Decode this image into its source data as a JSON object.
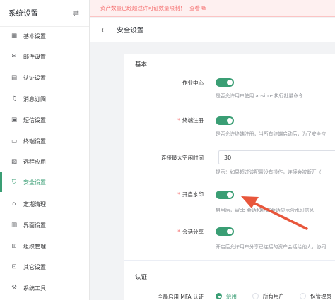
{
  "sidebar": {
    "title": "系统设置",
    "items": [
      {
        "icon": "grid-icon",
        "glyph": "▦",
        "label": "基本设置"
      },
      {
        "icon": "mail-icon",
        "glyph": "✉",
        "label": "邮件设置"
      },
      {
        "icon": "id-card-icon",
        "glyph": "▤",
        "label": "认证设置"
      },
      {
        "icon": "bell-icon",
        "glyph": "♫",
        "label": "消息订阅"
      },
      {
        "icon": "sms-icon",
        "glyph": "▣",
        "label": "短信设置"
      },
      {
        "icon": "monitor-icon",
        "glyph": "▭",
        "label": "终端设置"
      },
      {
        "icon": "app-icon",
        "glyph": "▧",
        "label": "远程应用"
      },
      {
        "icon": "shield-icon",
        "glyph": "⛉",
        "label": "安全设置"
      },
      {
        "icon": "broom-icon",
        "glyph": "⌂",
        "label": "定期清理"
      },
      {
        "icon": "layout-icon",
        "glyph": "▥",
        "label": "界面设置"
      },
      {
        "icon": "org-icon",
        "glyph": "⊞",
        "label": "组织管理"
      },
      {
        "icon": "more-icon",
        "glyph": "⊡",
        "label": "其它设置"
      },
      {
        "icon": "tools-icon",
        "glyph": "⚒",
        "label": "系统工具"
      }
    ],
    "active_index": 7
  },
  "notice": {
    "text": "资产数量已经超过许可证数量限制！",
    "link": "查看"
  },
  "header": {
    "title": "安全设置"
  },
  "sections": {
    "basic": "基本",
    "auth": "认证"
  },
  "fields": {
    "job_center": {
      "label": "作业中心",
      "enabled": true,
      "help": "是否允许用户使用 ansible 执行批量命令"
    },
    "terminal_register": {
      "label": "终端注册",
      "required": true,
      "enabled": true,
      "help": "是否允许终端注册，当所有终端启动后，为了安全应"
    },
    "idle_time": {
      "label": "连接最大空闲时间",
      "value": "30",
      "help": "提示：如果超过该配置没有操作，连接会被断开（"
    },
    "watermark": {
      "label": "开启水印",
      "required": true,
      "enabled": true,
      "help": "启用后，Web 会话和终端会话显示含水印信息"
    },
    "session_share": {
      "label": "会话分享",
      "required": true,
      "enabled": true,
      "help": "开启后允许用户分享已连接的资产会话给他人，协同"
    },
    "mfa": {
      "label": "全局启用 MFA 认证",
      "options": [
        "禁用",
        "所有用户",
        "仅管理员"
      ],
      "selected": 0
    }
  },
  "colors": {
    "accent": "#3a9e74",
    "danger": "#f56c6c",
    "annotation": "#e8563b"
  }
}
